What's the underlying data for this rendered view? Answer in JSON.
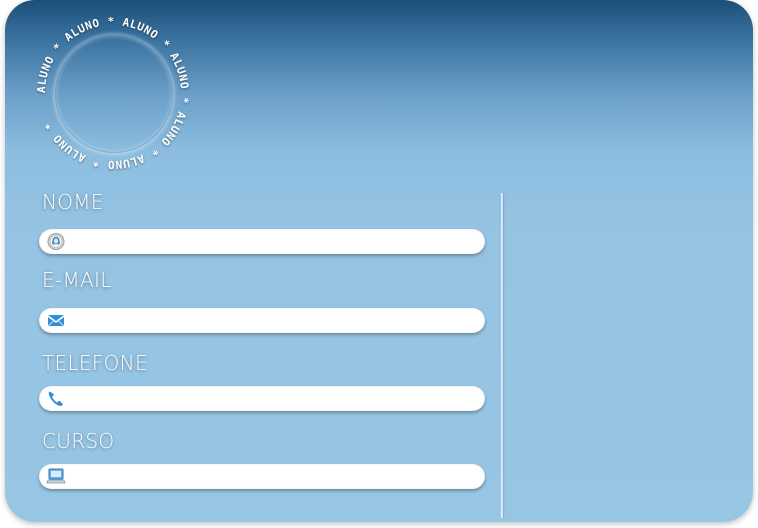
{
  "seal": {
    "text": "ALUNO * ALUNO * ALUNO * ALUNO * ALUNO * ALUNO * ALUNO *"
  },
  "form": {
    "nome": {
      "label": "NOME",
      "value": "",
      "icon": "user-icon"
    },
    "email": {
      "label": "E-MAIL",
      "value": "",
      "icon": "envelope-icon"
    },
    "telefone": {
      "label": "TELEFONE",
      "value": "",
      "icon": "phone-icon"
    },
    "curso": {
      "label": "CURSO",
      "value": "",
      "icon": "computer-book-icon"
    }
  },
  "colors": {
    "card_top": "#1c4f78",
    "card_body": "#97c6e5",
    "icon_blue": "#2f8fd6"
  }
}
